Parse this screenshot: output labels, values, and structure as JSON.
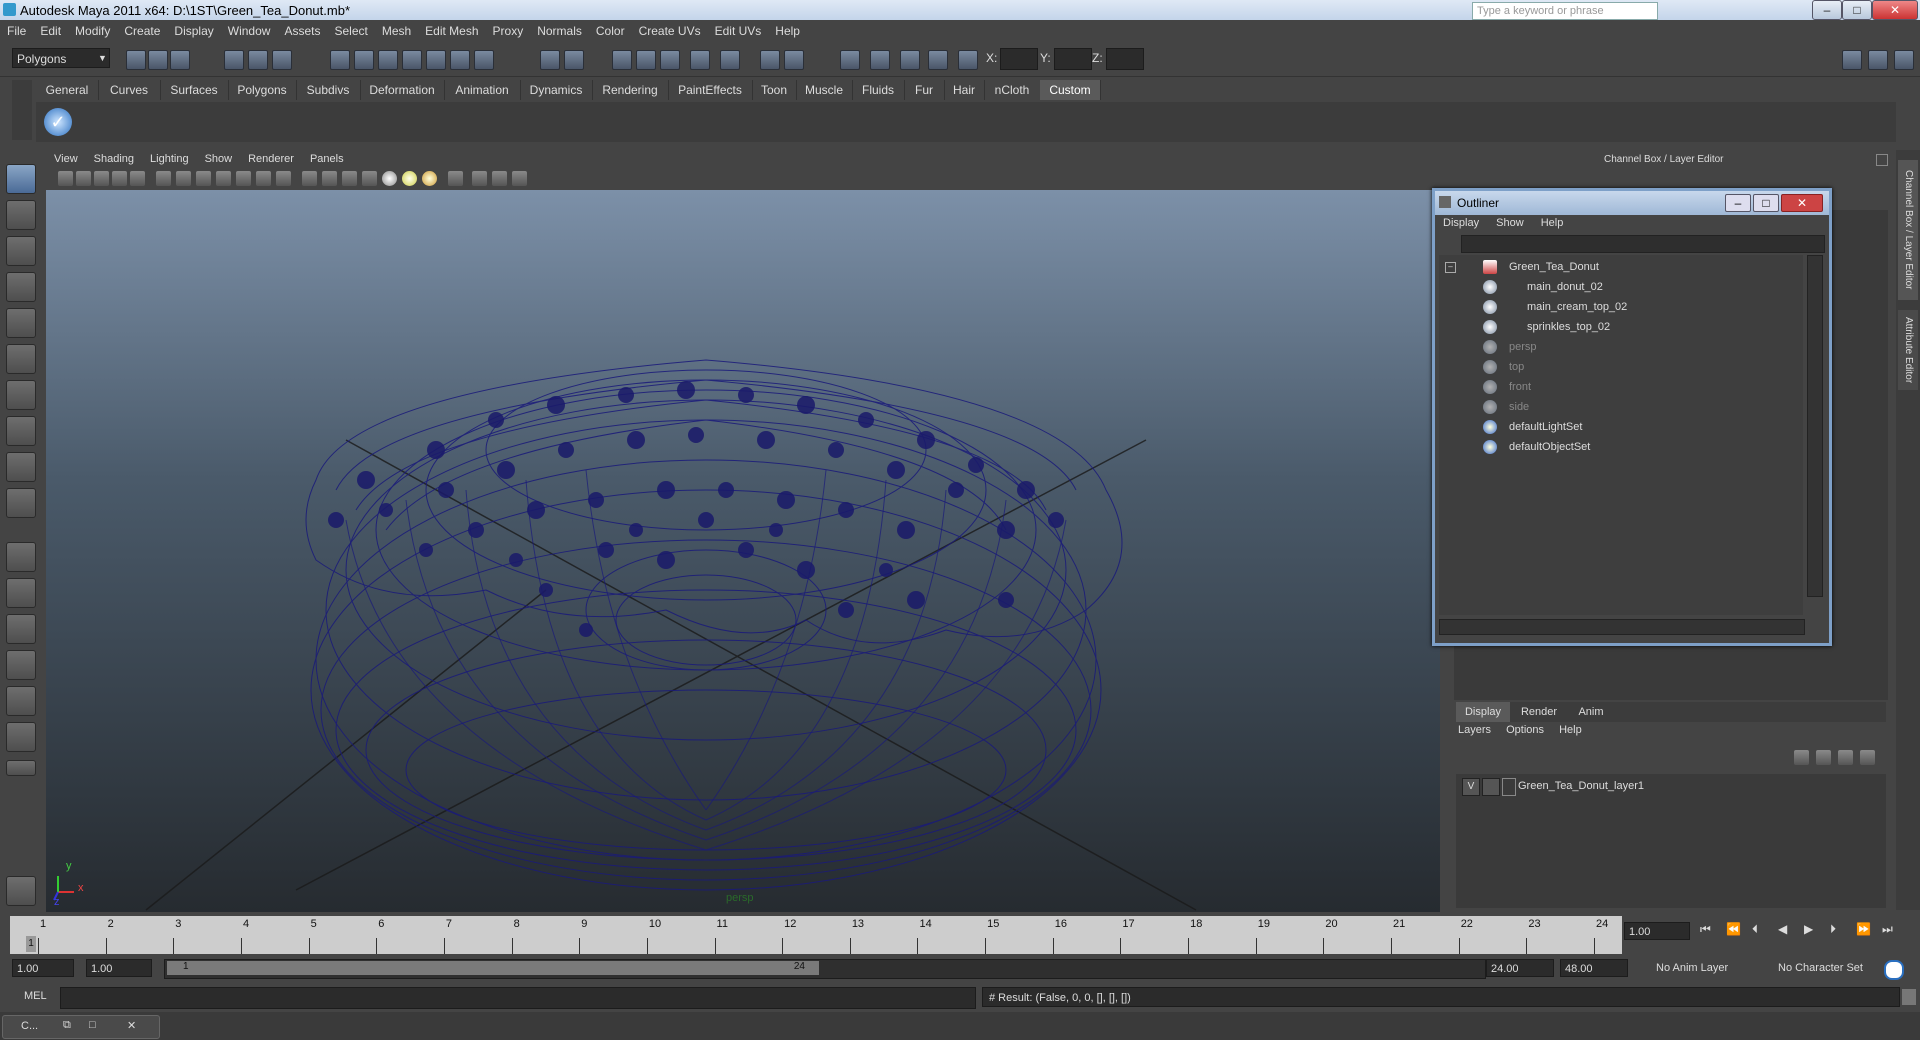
{
  "window": {
    "title": "Autodesk Maya 2011 x64: D:\\1ST\\Green_Tea_Donut.mb*",
    "search_placeholder": "Type a keyword or phrase",
    "min": "–",
    "max": "□",
    "close": "✕"
  },
  "menu": [
    "File",
    "Edit",
    "Modify",
    "Create",
    "Display",
    "Window",
    "Assets",
    "Select",
    "Mesh",
    "Edit Mesh",
    "Proxy",
    "Normals",
    "Color",
    "Create UVs",
    "Edit UVs",
    "Help"
  ],
  "toolbar": {
    "mode": "Polygons",
    "x_label": "X:",
    "y_label": "Y:",
    "z_label": "Z:"
  },
  "shelf_tabs": [
    "General",
    "Curves",
    "Surfaces",
    "Polygons",
    "Subdivs",
    "Deformation",
    "Animation",
    "Dynamics",
    "Rendering",
    "PaintEffects",
    "Toon",
    "Muscle",
    "Fluids",
    "Fur",
    "Hair",
    "nCloth",
    "Custom"
  ],
  "shelf_active": "Custom",
  "panel_menu": [
    "View",
    "Shading",
    "Lighting",
    "Show",
    "Renderer",
    "Panels"
  ],
  "viewport": {
    "camera_label": "persp",
    "axis_x": "x",
    "axis_y": "y",
    "axis_z": "z"
  },
  "channelbox": {
    "title": "Channel Box / Layer Editor"
  },
  "outliner": {
    "title": "Outliner",
    "menu": [
      "Display",
      "Show",
      "Help"
    ],
    "items": [
      {
        "label": "Green_Tea_Donut",
        "indent": 0,
        "dim": false
      },
      {
        "label": "main_donut_02",
        "indent": 1,
        "dim": false
      },
      {
        "label": "main_cream_top_02",
        "indent": 1,
        "dim": false
      },
      {
        "label": "sprinkles_top_02",
        "indent": 1,
        "dim": false
      },
      {
        "label": "persp",
        "indent": 0,
        "dim": true
      },
      {
        "label": "top",
        "indent": 0,
        "dim": true
      },
      {
        "label": "front",
        "indent": 0,
        "dim": true
      },
      {
        "label": "side",
        "indent": 0,
        "dim": true
      },
      {
        "label": "defaultLightSet",
        "indent": 0,
        "dim": false
      },
      {
        "label": "defaultObjectSet",
        "indent": 0,
        "dim": false
      }
    ]
  },
  "layers": {
    "tabs": [
      "Display",
      "Render",
      "Anim"
    ],
    "menu": [
      "Layers",
      "Options",
      "Help"
    ],
    "visible": "V",
    "layer_name": "Green_Tea_Donut_layer1"
  },
  "timeline": {
    "ticks": [
      "1",
      "2",
      "3",
      "4",
      "5",
      "6",
      "7",
      "8",
      "9",
      "10",
      "11",
      "12",
      "13",
      "14",
      "15",
      "16",
      "17",
      "18",
      "19",
      "20",
      "21",
      "22",
      "23",
      "24"
    ],
    "current_frame_marker": "1",
    "current_time": "1.00"
  },
  "range": {
    "start": "1.00",
    "start2": "1.00",
    "slider_start": "1",
    "slider_end": "24",
    "end": "24.00",
    "end2": "48.00",
    "anim_layer": "No Anim Layer",
    "char_set": "No Character Set"
  },
  "command": {
    "lang": "MEL",
    "result": "# Result: (False, 0, 0, [], [], [])"
  },
  "taskbar": {
    "item": "C..."
  },
  "side_tabs": {
    "channel": "Channel Box / Layer Editor",
    "attr": "Attribute Editor"
  },
  "colors": {
    "wire": "#1a1a7a",
    "accent": "#7ea0c8"
  }
}
